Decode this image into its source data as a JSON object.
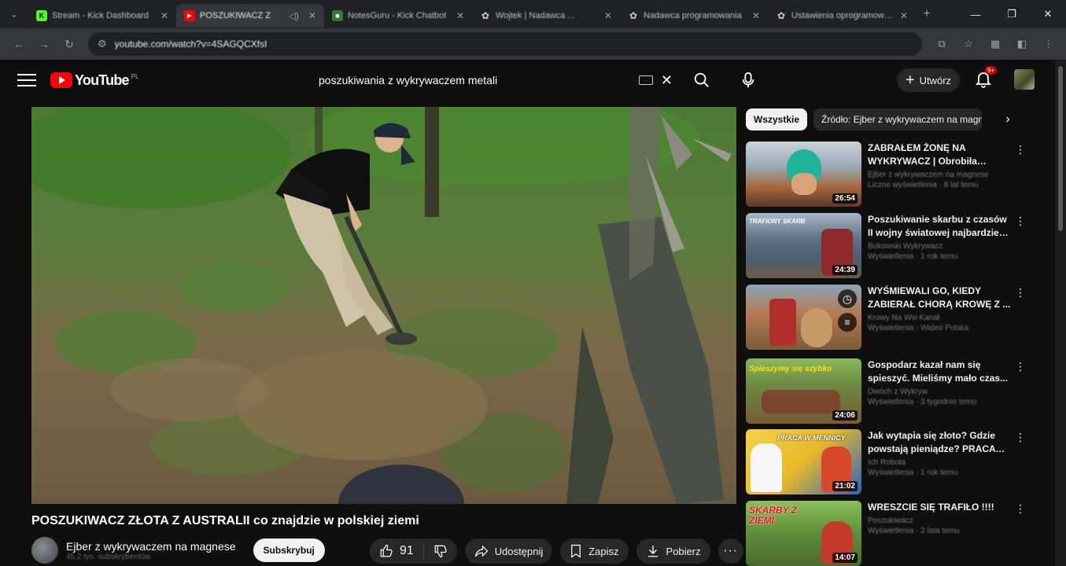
{
  "browser": {
    "tabs": [
      {
        "title": "Stream - Kick Dashboard",
        "favicon_color": "#53fc18",
        "favicon": "K",
        "active": false
      },
      {
        "title": "POSZUKIWACZ Z",
        "favicon_color": "#ff0000",
        "favicon": "▶",
        "active": true
      },
      {
        "title": "NotesGuru - Kick Chatbot",
        "favicon_color": "#2e7d32",
        "favicon": "■",
        "active": false
      },
      {
        "title": "Wojtek | Nadawca ...",
        "favicon_color": "#888888",
        "favicon": "✿",
        "active": false
      },
      {
        "title": "Nadawca programowania",
        "favicon_color": "#888888",
        "favicon": "✿",
        "active": false
      },
      {
        "title": "Ustawienia oprogramowania",
        "favicon_color": "#888888",
        "favicon": "✿",
        "active": false
      }
    ],
    "url": "youtube.com/watch?v=4SAGQCXfsI"
  },
  "header": {
    "logo_text": "YouTube",
    "country_code": "PL",
    "search_query": "poszukiwania z wykrywaczem metali",
    "create_label": "Utwórz",
    "notification_count": "9+"
  },
  "video": {
    "title": "POSZUKIWACZ ZŁOTA Z AUSTRALII co znajdzie w polskiej ziemi",
    "channel_name": "Ejber z wykrywaczem na magnese",
    "channel_subs": "45,2 tys. subskrybentów",
    "subscribe_label": "Subskrybuj",
    "likes": "91",
    "share_label": "Udostępnij",
    "save_label": "Zapisz",
    "download_label": "Pobierz",
    "more_label": "···"
  },
  "chips": {
    "all": "Wszystkie",
    "source": "Źródło: Ejber z wykrywaczem na magnese"
  },
  "recommendations": [
    {
      "title": "ZABRAŁEM ŻONĘ NA WYKRYWACZ | Obrobiła danat...",
      "channel": "Ejber z wykrywaczem na magnese",
      "views": "Liczne wyświetlenia · 8 lat temu",
      "duration": "26:54",
      "thumb_text": ""
    },
    {
      "title": "Poszukiwanie skarbu z czasów II wojny światowej najbardziej ...",
      "channel": "Bukowski Wykrywacz",
      "views": "Wyświetlenia · 1 rok temu",
      "duration": "24:39",
      "thumb_text": "TRAFIONY SKARB"
    },
    {
      "title": "WYŚMIEWALI GO, KIEDY ZABIERAŁ CHORĄ KROWĘ Z ...",
      "channel": "Krowy Na Wsi Kanał",
      "views": "Wyświetlenia · Wideo Polska",
      "duration": "",
      "thumb_text": ""
    },
    {
      "title": "Gospodarz kazał nam się spieszyć. Mieliśmy mało czas...",
      "channel": "Dwóch z Wykryw",
      "views": "Wyświetlenia · 3 tygodnie temu",
      "duration": "24:06",
      "thumb_text": "Spieszymy się szybko"
    },
    {
      "title": "Jak wytapia się złoto? Gdzie powstają pieniądze? PRACA W...",
      "channel": "Ich Robota",
      "views": "Wyświetlenia · 1 rok temu",
      "duration": "21:02",
      "thumb_text": "PRACA W MENNICY"
    },
    {
      "title": "WRESZCIE SIĘ TRAFIŁO !!!!",
      "channel": "Poszukiwacz",
      "views": "Wyświetlenia · 2 lata temu",
      "duration": "14:07",
      "thumb_text": "SKARBY Z ZIEMI"
    }
  ],
  "colors": {
    "accent": "#ff0000",
    "background": "#0f0f0f",
    "pill": "#272727"
  }
}
